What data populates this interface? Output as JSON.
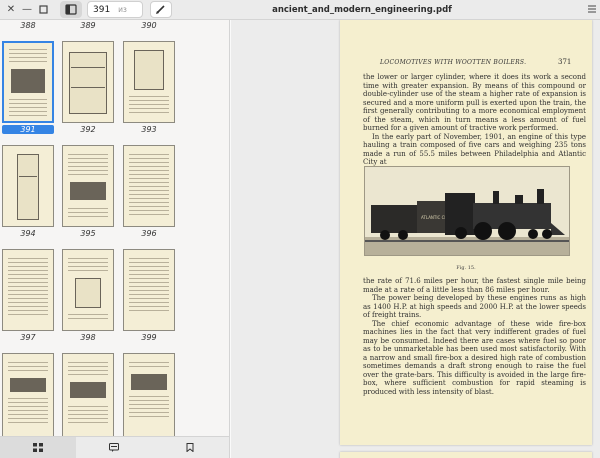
{
  "header": {
    "current_page": "391",
    "page_total": "из 458",
    "document_title": "ancient_and_modern_engineering.pdf"
  },
  "sidebar": {
    "top_labels": [
      "388",
      "389",
      "390"
    ],
    "thumbnails": [
      {
        "label": "391",
        "selected": true
      },
      {
        "label": "392"
      },
      {
        "label": "393"
      },
      {
        "label": "394"
      },
      {
        "label": "395"
      },
      {
        "label": "396"
      },
      {
        "label": "397"
      },
      {
        "label": "398"
      },
      {
        "label": "399"
      }
    ],
    "tabs": [
      "thumbnails-icon",
      "outline-icon",
      "bookmarks-icon"
    ]
  },
  "page": {
    "running_head": "LOCOMOTIVES WITH WOOTTEN BOILERS.",
    "page_number": "371",
    "para1": "the lower or larger cylinder, where it does its work a second time with greater expansion. By means of this compound or double-cylinder use of the steam a higher rate of expansion is secured and a more uniform pull is exerted upon the train, the first generally contributing to a more economical employment of the steam, which in turn means a less amount of fuel burned for a given amount of tractive work performed.",
    "para2": "In the early part of November, 1901, an engine of this type hauling a train composed of five cars and weighing 235 tons made a run of 55.5 miles between Philadelphia and Atlantic City at",
    "figure_caption": "Fig. 15.",
    "para3": "the rate of 71.6 miles per hour, the fastest single mile being made at a rate of a little less than 86 miles per hour.",
    "para4": "The power being developed by these engines runs as high as 1400 H.P. at high speeds and 2000 H.P. at the lower speeds of freight trains.",
    "para5": "The chief economic advantage of these wide fire-box machines lies in the fact that very indifferent grades of fuel may be consumed. Indeed there are cases where fuel so poor as to be unmarketable has been used most satisfactorily. With a narrow and small fire-box a desired high rate of combustion sometimes demands a draft strong enough to raise the fuel over the grate-bars. This difficulty is avoided in the large fire-box, where sufficient combustion for rapid steaming is produced with less intensity of blast."
  }
}
